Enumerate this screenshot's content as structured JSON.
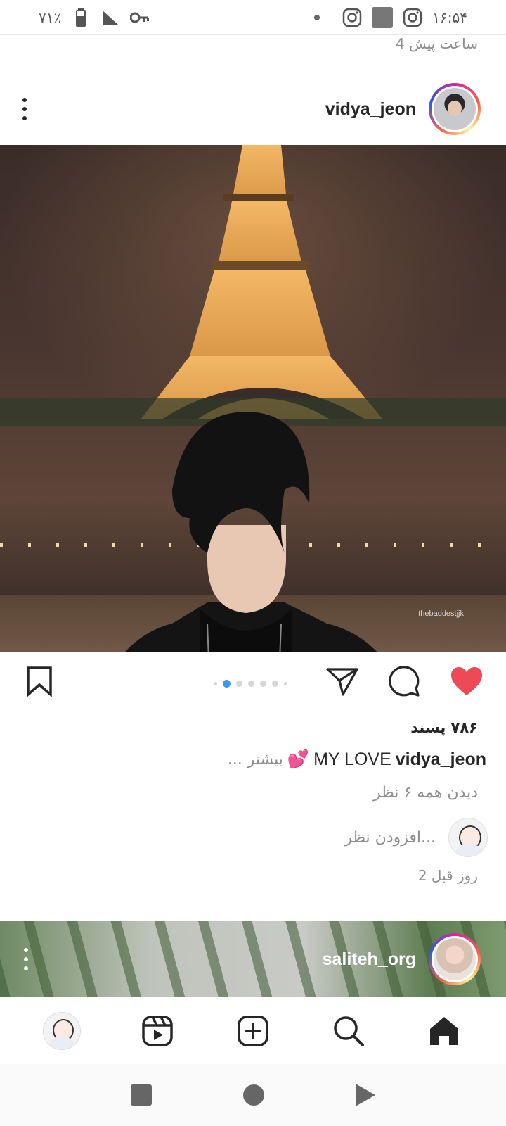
{
  "status_bar": {
    "time": "۱۶:۵۴",
    "battery": "۷۱٪",
    "icons": [
      "instagram-icon",
      "gallery-icon",
      "instagram-icon",
      "notification-dot-icon",
      "key-icon",
      "signal-icon",
      "battery-icon"
    ]
  },
  "previous_post": {
    "time_ago": "4 ساعت پیش"
  },
  "post": {
    "username": "vidya_jeon",
    "watermark": "thebaddestjjk",
    "carousel": {
      "total": 6,
      "active_index": 1
    },
    "likes": "۷۸۶ پسند",
    "caption_user": "vidya_jeon",
    "caption_text": "MY LOVE",
    "caption_emoji": "💕",
    "more_label": "... بیشتر",
    "view_comments": "دیدن همه ۶ نظر",
    "add_comment_placeholder": "افزودن نظر...",
    "time_ago": "2 روز قبل",
    "liked": true,
    "colors": {
      "like": "#ed4956",
      "active_dot": "#3897f0"
    }
  },
  "next_post": {
    "username": "saliteh_org"
  },
  "bottom_nav": {
    "items": [
      "profile-avatar",
      "reels-icon",
      "create-icon",
      "search-icon",
      "home-icon"
    ],
    "active": "home-icon"
  },
  "system_nav": {
    "items": [
      "recents-icon",
      "home-circle-icon",
      "back-icon"
    ]
  }
}
